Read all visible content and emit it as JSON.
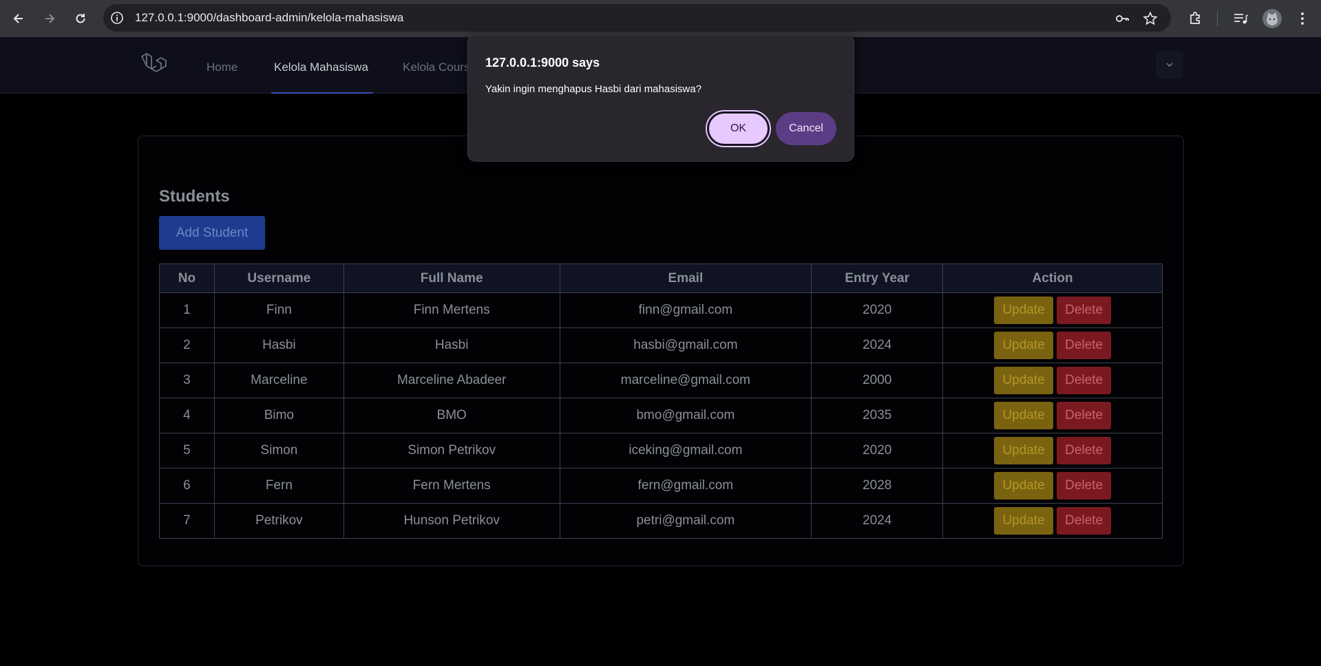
{
  "browser": {
    "url": "127.0.0.1:9000/dashboard-admin/kelola-mahasiswa"
  },
  "nav": {
    "links": [
      "Home",
      "Kelola Mahasiswa",
      "Kelola Cours"
    ]
  },
  "students": {
    "title": "Students",
    "add_label": "Add Student",
    "columns": [
      "No",
      "Username",
      "Full Name",
      "Email",
      "Entry Year",
      "Action"
    ],
    "update_label": "Update",
    "delete_label": "Delete",
    "rows": [
      [
        "1",
        "Finn",
        "Finn Mertens",
        "finn@gmail.com",
        "2020"
      ],
      [
        "2",
        "Hasbi",
        "Hasbi",
        "hasbi@gmail.com",
        "2024"
      ],
      [
        "3",
        "Marceline",
        "Marceline Abadeer",
        "marceline@gmail.com",
        "2000"
      ],
      [
        "4",
        "Bimo",
        "BMO",
        "bmo@gmail.com",
        "2035"
      ],
      [
        "5",
        "Simon",
        "Simon Petrikov",
        "iceking@gmail.com",
        "2020"
      ],
      [
        "6",
        "Fern",
        "Fern Mertens",
        "fern@gmail.com",
        "2028"
      ],
      [
        "7",
        "Petrikov",
        "Hunson Petrikov",
        "petri@gmail.com",
        "2024"
      ]
    ]
  },
  "dialog": {
    "title": "127.0.0.1:9000 says",
    "message": "Yakin ingin menghapus Hasbi dari mahasiswa?",
    "ok_label": "OK",
    "cancel_label": "Cancel"
  }
}
